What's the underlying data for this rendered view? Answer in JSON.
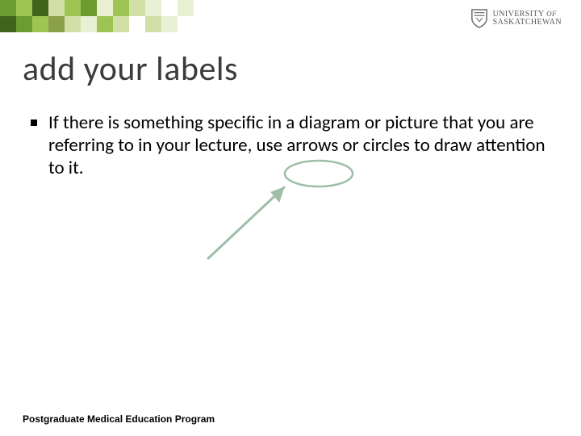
{
  "header": {
    "university_top": "UNIVERSITY OF",
    "university_bottom": "SASKATCHEWAN",
    "mosaic_colors": {
      "dark": "#41641c",
      "mid": "#6c9b2f",
      "light": "#9ec553",
      "pale": "#d2e0a8",
      "xpale": "#eaf0d3",
      "olive": "#8aa04a"
    }
  },
  "title": "add your labels",
  "bullets": [
    "If there is something specific in a diagram or picture that you are referring to in your lecture,  use arrows or circles to draw attention to it."
  ],
  "annotation": {
    "stroke": "#9fbea8"
  },
  "footer": "Postgraduate Medical Education Program"
}
